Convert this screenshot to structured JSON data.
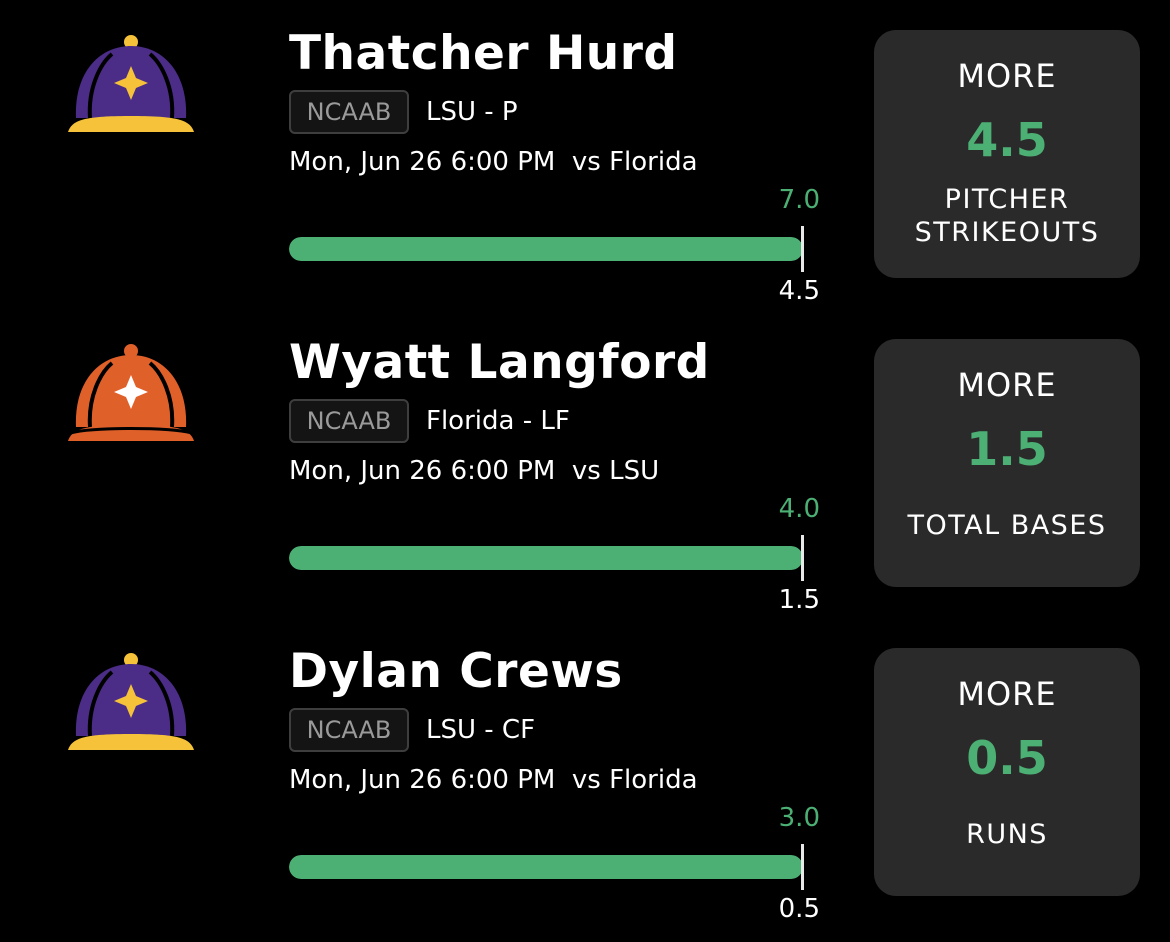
{
  "colors": {
    "background": "#000000",
    "accent_green": "#4caf74",
    "card_bg": "#2a2a2a",
    "badge_border": "#3e3e3e",
    "lsu_purple": "#4b2c86",
    "lsu_gold": "#f5c23a",
    "florida_orange": "#e0602a"
  },
  "players": [
    {
      "name": "Thatcher Hurd",
      "cap_icon": "lsu-cap-icon",
      "league": "NCAAB",
      "team_position": "LSU - P",
      "game_time": "Mon, Jun 26 6:00 PM",
      "opponent": "vs Florida",
      "projection": "7.0",
      "line": "4.5",
      "progress_fraction": 1.0,
      "pick_direction": "MORE",
      "pick_line": "4.5",
      "stat_line1": "PITCHER",
      "stat_line2": "STRIKEOUTS"
    },
    {
      "name": "Wyatt Langford",
      "cap_icon": "florida-cap-icon",
      "league": "NCAAB",
      "team_position": "Florida - LF",
      "game_time": "Mon, Jun 26 6:00 PM",
      "opponent": "vs LSU",
      "projection": "4.0",
      "line": "1.5",
      "progress_fraction": 1.0,
      "pick_direction": "MORE",
      "pick_line": "1.5",
      "stat_line1": "TOTAL BASES",
      "stat_line2": ""
    },
    {
      "name": "Dylan Crews",
      "cap_icon": "lsu-cap-icon",
      "league": "NCAAB",
      "team_position": "LSU - CF",
      "game_time": "Mon, Jun 26 6:00 PM",
      "opponent": "vs Florida",
      "projection": "3.0",
      "line": "0.5",
      "progress_fraction": 1.0,
      "pick_direction": "MORE",
      "pick_line": "0.5",
      "stat_line1": "RUNS",
      "stat_line2": ""
    }
  ]
}
